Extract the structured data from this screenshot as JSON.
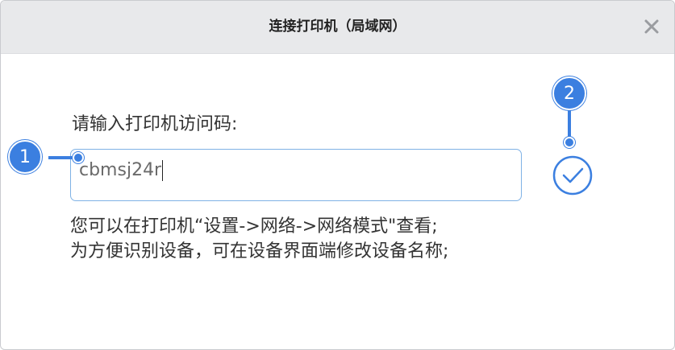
{
  "dialog": {
    "title": "连接打印机（局域网）",
    "close_icon": "close-icon"
  },
  "form": {
    "prompt": "请输入打印机访问码:",
    "access_code_value": "cbmsj24r",
    "confirm_icon": "check-circle-icon"
  },
  "hint": {
    "line1": "您可以在打印机“设置->网络->网络模式\"查看;",
    "line2": "为方便识别设备，可在设备界面端修改设备名称;"
  },
  "callouts": {
    "marker1": "1",
    "marker2": "2"
  },
  "colors": {
    "accent": "#3b7fe0",
    "input_border": "#7fb2e5",
    "titlebar_bg": "#e8e9eb"
  }
}
